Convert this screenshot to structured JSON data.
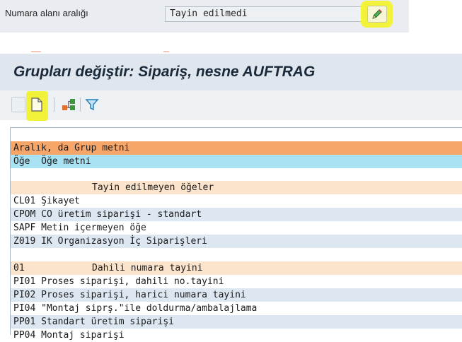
{
  "range_field": {
    "label": "Numara alanı aralığı",
    "value": "Tayin edilmedi",
    "edit_button_icon": "pencil-icon"
  },
  "screen": {
    "title": "Grupları değiştir: Sipariş, nesne AUFTRAG"
  },
  "toolbar": {
    "buttons": [
      "blank-button",
      "new-document-icon",
      "hierarchy-icon",
      "filter-icon"
    ]
  },
  "list": {
    "header_group": "Aralık, da Grup metni",
    "header_element": "Öğe  Öğe metni",
    "groups": [
      {
        "code": "",
        "title": "Tayin edilmeyen öğeler",
        "items": [
          {
            "code": "CL01",
            "text": "Şikayet"
          },
          {
            "code": "CPOM",
            "text": "CO üretim siparişi - standart"
          },
          {
            "code": "SAPF",
            "text": "Metin içermeyen öğe"
          },
          {
            "code": "Z019",
            "text": "IK Organizasyon İç Siparişleri"
          }
        ]
      },
      {
        "code": "01",
        "title": "Dahili numara tayini",
        "items": [
          {
            "code": "PI01",
            "text": "Proses siparişi, dahili no.tayini"
          },
          {
            "code": "PI02",
            "text": "Proses siparişi, harici numara tayini"
          },
          {
            "code": "PI04",
            "text": "\"Montaj siprş.\"ile doldurma/ambalajlama"
          },
          {
            "code": "PP01",
            "text": "Standart üretim siparişi"
          },
          {
            "code": "PP04",
            "text": "Montaj siparişi"
          }
        ]
      }
    ]
  },
  "colors": {
    "header_orange": "#f6a668",
    "header_cyan": "#a9e2f3",
    "group_peach": "#fce4cc",
    "row_blue": "#dde7f2",
    "highlight_yellow": "#f2f23a"
  }
}
